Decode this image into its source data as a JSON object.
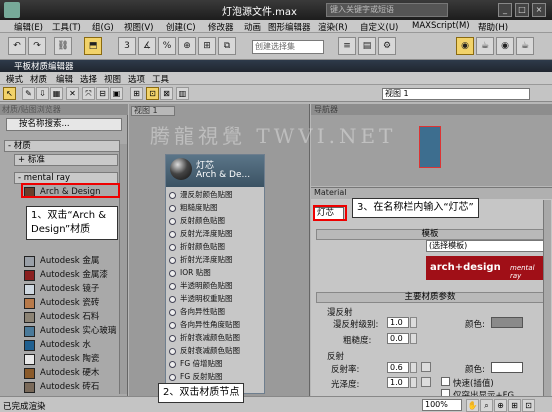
{
  "app": {
    "title": "灯泡源文件.max",
    "search_placeholder": "键入关键字或短语",
    "window_buttons": [
      "_",
      "□",
      "×"
    ]
  },
  "main_menu": [
    "编辑(E)",
    "工具(T)",
    "组(G)",
    "视图(V)",
    "创建(C)",
    "修改器",
    "动画",
    "图形编辑器",
    "渲染(R)",
    "自定义(U)",
    "MAXScript(M)",
    "帮助(H)"
  ],
  "main_toolbar": {
    "selection_set_placeholder": "创建选择集",
    "buttons": [
      "↶",
      "↷",
      "⛓",
      "✂",
      "⬒",
      "▣",
      "3",
      "∡",
      "%",
      "⊕",
      "⊞",
      "⧉",
      "≡",
      "▤",
      "⚙",
      "◉",
      "☕"
    ]
  },
  "slate": {
    "title": "平板材质编辑器",
    "menu": [
      "模式",
      "材质",
      "编辑",
      "选择",
      "视图",
      "选项",
      "工具"
    ],
    "view_select": "视图 1",
    "browser": {
      "header": "材质/贴图浏览器",
      "search": "按名称搜索...",
      "rollouts": [
        "- 材质",
        "+ 标准",
        "- mental ray"
      ],
      "materials": [
        {
          "name": "Arch & Design",
          "color": "#6b3e2a"
        },
        {
          "name": "Autodesk 金属",
          "color": "#9aa0a8"
        },
        {
          "name": "Autodesk 金属漆",
          "color": "#8a1f1f"
        },
        {
          "name": "Autodesk 镜子",
          "color": "#cfd8e0"
        },
        {
          "name": "Autodesk 瓷砖",
          "color": "#b87a4a"
        },
        {
          "name": "Autodesk 石料",
          "color": "#8c8374"
        },
        {
          "name": "Autodesk 实心玻璃",
          "color": "#4a7a9a"
        },
        {
          "name": "Autodesk 水",
          "color": "#1f5f8f"
        },
        {
          "name": "Autodesk 陶瓷",
          "color": "#e8e8e8"
        },
        {
          "name": "Autodesk 硬木",
          "color": "#8a5a2a"
        },
        {
          "name": "Autodesk 砖石 CMU",
          "color": "#7a6a5a"
        }
      ]
    },
    "view_tab": "视图 1",
    "node": {
      "title": "灯芯",
      "subtitle": "Arch & De...",
      "slots": [
        "漫反射颜色贴图",
        "粗糙度贴图",
        "反射颜色贴图",
        "反射光泽度贴图",
        "折射颜色贴图",
        "折射光泽度贴图",
        "IOR 贴图",
        "半透明颜色贴图",
        "半透明权重贴图",
        "各向异性贴图",
        "各向异性角度贴图",
        "折射衰减颜色贴图",
        "反射衰减颜色贴图",
        "FG 倍增贴图",
        "FG 反射贴图"
      ]
    },
    "navigator_header": "导航器",
    "params": {
      "header": "Material",
      "name_value": "灯芯",
      "template_section": "模板",
      "template_value": "(选择模板)",
      "banner_left": "arch+design",
      "banner_right": "mental ray",
      "main_section": "主要材质参数",
      "diffuse_title": "漫反射",
      "diffuse_level_label": "漫反射级别:",
      "diffuse_level": "1.0",
      "roughness_label": "粗糙度:",
      "roughness": "0.0",
      "color_label": "颜色:",
      "reflect_title": "反射",
      "reflectivity_label": "反射率:",
      "reflectivity": "0.6",
      "gloss_label": "光泽度:",
      "gloss": "1.0",
      "fast_label": "快速(插值)",
      "highlight_label": "仅突出显示+FG"
    },
    "status": "已完成渲染",
    "zoom": "100%"
  },
  "colors": {
    "diffuse_swatch": "#8a8a8a",
    "reflect_swatch": "#ffffff",
    "highlight": "#e00000"
  },
  "annotations": {
    "a1_line1": "1、双击“Arch &",
    "a1_line2": "Design”材质",
    "a2": "2、双击材质节点",
    "a3": "3、在名称栏内输入“灯芯”",
    "watermark": "腾龍視覺 TWVI.NET"
  }
}
